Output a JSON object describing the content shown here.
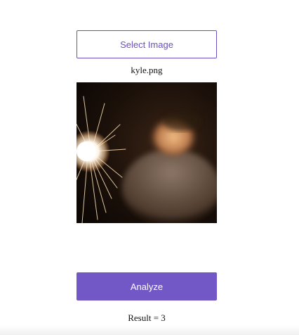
{
  "select_button": {
    "label": "Select Image"
  },
  "file": {
    "name": "kyle.png"
  },
  "analyze_button": {
    "label": "Analyze"
  },
  "result": {
    "text": "Result = 3"
  },
  "colors": {
    "accent": "#7258c7",
    "accent_border": "#6a4fc4"
  }
}
